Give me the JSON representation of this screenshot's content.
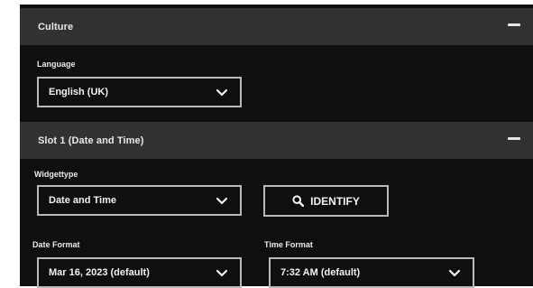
{
  "sections": {
    "culture": {
      "title": "Culture",
      "collapse_icon": "minus-icon"
    },
    "slot1": {
      "title": "Slot 1 (Date and Time)",
      "collapse_icon": "minus-icon"
    }
  },
  "language": {
    "label": "Language",
    "value": "English (UK)"
  },
  "widgettype": {
    "label": "Widgettype",
    "value": "Date and Time"
  },
  "identify": {
    "label": "IDENTIFY",
    "icon": "search-icon"
  },
  "date_format": {
    "label": "Date Format",
    "value": "Mar 16, 2023 (default)"
  },
  "time_format": {
    "label": "Time Format",
    "value": "7:32 AM (default)"
  },
  "colors": {
    "background": "#0f0f10",
    "section_header": "#313233",
    "border": "#b9b9b9",
    "text": "#f2f2f2"
  }
}
